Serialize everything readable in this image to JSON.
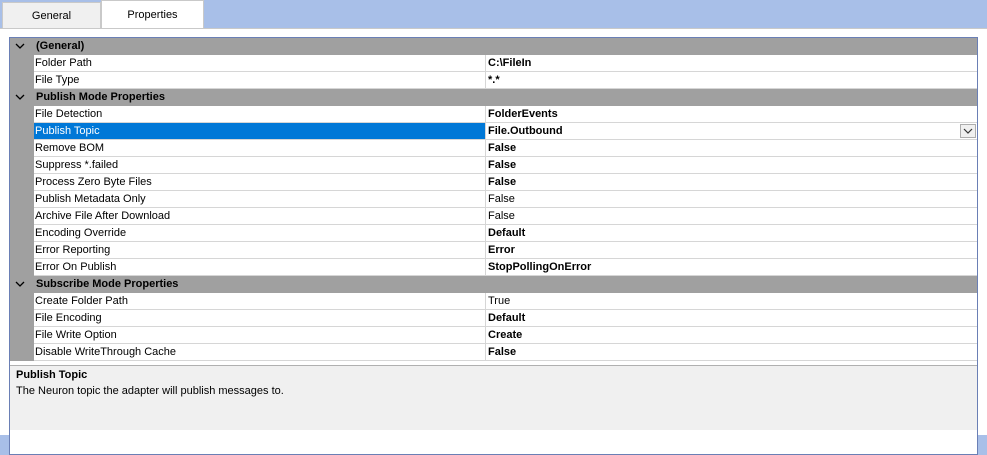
{
  "tabs": [
    {
      "label": "General"
    },
    {
      "label": "Properties"
    }
  ],
  "active_tab": "Properties",
  "property_grid": {
    "categories": [
      {
        "label": "(General)",
        "properties": [
          {
            "name": "Folder Path",
            "value": "C:\\FileIn",
            "bold": true
          },
          {
            "name": "File Type",
            "value": "*.*",
            "bold": true
          }
        ]
      },
      {
        "label": "Publish Mode Properties",
        "properties": [
          {
            "name": "File Detection",
            "value": "FolderEvents",
            "bold": true
          },
          {
            "name": "Publish Topic",
            "value": "File.Outbound",
            "bold": true,
            "selected": true
          },
          {
            "name": "Remove BOM",
            "value": "False",
            "bold": true
          },
          {
            "name": "Suppress *.failed",
            "value": "False",
            "bold": true
          },
          {
            "name": "Process Zero Byte Files",
            "value": "False",
            "bold": true
          },
          {
            "name": "Publish Metadata Only",
            "value": "False",
            "bold": false
          },
          {
            "name": "Archive File After Download",
            "value": "False",
            "bold": false
          },
          {
            "name": "Encoding Override",
            "value": "Default",
            "bold": true
          },
          {
            "name": "Error Reporting",
            "value": "Error",
            "bold": true
          },
          {
            "name": "Error On Publish",
            "value": "StopPollingOnError",
            "bold": true
          }
        ]
      },
      {
        "label": "Subscribe Mode Properties",
        "properties": [
          {
            "name": "Create Folder Path",
            "value": "True",
            "bold": false
          },
          {
            "name": "File Encoding",
            "value": "Default",
            "bold": true
          },
          {
            "name": "File Write Option",
            "value": "Create",
            "bold": true
          },
          {
            "name": "Disable WriteThrough Cache",
            "value": "False",
            "bold": true
          }
        ]
      }
    ]
  },
  "description": {
    "title": "Publish Topic",
    "text": "The Neuron topic the adapter will publish messages to."
  },
  "colors": {
    "selected_row": "#0078d7",
    "category_bar": "#a0a0a0",
    "tabstrip_bg": "#a8bfe8"
  }
}
